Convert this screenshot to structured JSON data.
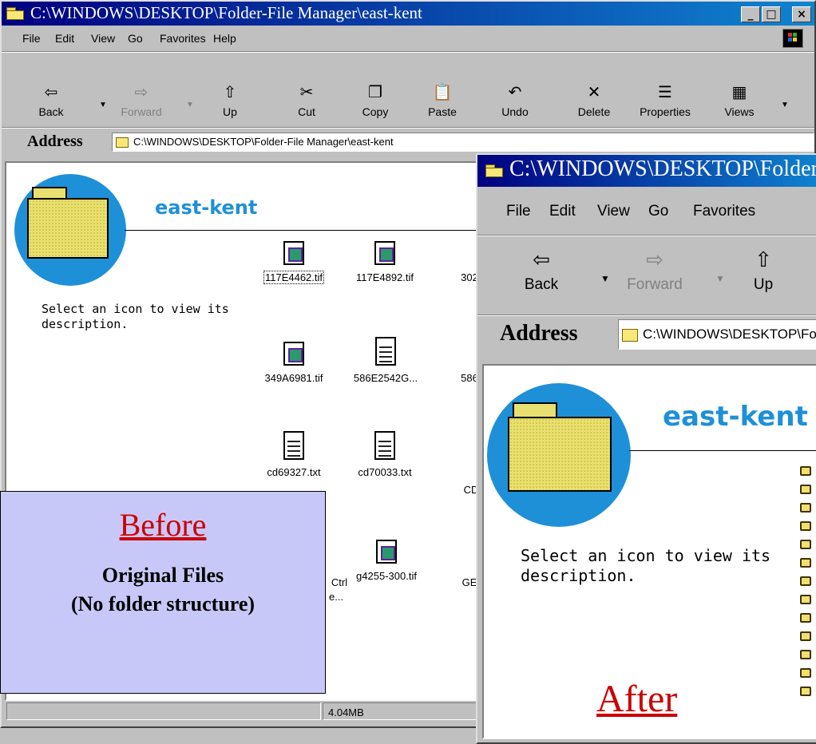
{
  "window1": {
    "title": "C:\\WINDOWS\\DESKTOP\\Folder-File Manager\\east-kent",
    "title_buttons": {
      "minimize": "_",
      "maximize": "□",
      "close": "×"
    },
    "menu": [
      "File",
      "Edit",
      "View",
      "Go",
      "Favorites",
      "Help"
    ],
    "toolbar": [
      {
        "label": "Back",
        "icon": "back-arrow-icon",
        "glyph": "⇦"
      },
      {
        "label": "Forward",
        "icon": "forward-arrow-icon",
        "glyph": "⇨"
      },
      {
        "label": "Up",
        "icon": "up-folder-icon",
        "glyph": "⇧"
      },
      {
        "label": "Cut",
        "icon": "scissors-icon",
        "glyph": "✂"
      },
      {
        "label": "Copy",
        "icon": "copy-icon",
        "glyph": "❐"
      },
      {
        "label": "Paste",
        "icon": "paste-icon",
        "glyph": "📋"
      },
      {
        "label": "Undo",
        "icon": "undo-icon",
        "glyph": "↶"
      },
      {
        "label": "Delete",
        "icon": "delete-icon",
        "glyph": "✕"
      },
      {
        "label": "Properties",
        "icon": "properties-icon",
        "glyph": "☰"
      },
      {
        "label": "Views",
        "icon": "views-icon",
        "glyph": "▦"
      }
    ],
    "address_label": "Address",
    "address_value": "C:\\WINDOWS\\DESKTOP\\Folder-File Manager\\east-kent",
    "folder_title": "east-kent",
    "description": "Select an icon to view its description.",
    "files": [
      {
        "name": "117E4462.tif",
        "type": "tif"
      },
      {
        "name": "117E4892.tif",
        "type": "tif"
      },
      {
        "name": "302",
        "type": "tif"
      },
      {
        "name": "349A6981.tif",
        "type": "tif"
      },
      {
        "name": "586E2542G...",
        "type": "txt"
      },
      {
        "name": "586",
        "type": "txt"
      },
      {
        "name": "cd69327.txt",
        "type": "txt"
      },
      {
        "name": "cd70033.txt",
        "type": "txt"
      },
      {
        "name": "CD",
        "type": "txt"
      },
      {
        "name": "Ctrl",
        "type": "txt"
      },
      {
        "name": "g4255-300.tif",
        "type": "tif"
      },
      {
        "name": "GE",
        "type": "txt"
      }
    ],
    "status_size": "4.04MB"
  },
  "window2": {
    "title": "C:\\WINDOWS\\DESKTOP\\Folder-File Manager\\east-kent",
    "menu": [
      "File",
      "Edit",
      "View",
      "Go",
      "Favorites"
    ],
    "toolbar": [
      {
        "label": "Back",
        "icon": "back-arrow-icon",
        "glyph": "⇦"
      },
      {
        "label": "Forward",
        "icon": "forward-arrow-icon",
        "glyph": "⇨"
      },
      {
        "label": "Up",
        "icon": "up-folder-icon",
        "glyph": "⇧"
      }
    ],
    "address_label": "Address",
    "address_value": "C:\\WINDOWS\\DESKTOP\\Folder-File Manager\\east-kent",
    "folder_title": "east-kent",
    "description": "Select an icon to view its description."
  },
  "callouts": {
    "before_heading": "Before",
    "before_line1": "Original Files",
    "before_line2": "(No folder structure)",
    "after_heading": "After"
  },
  "colors": {
    "title_bar": "#000080",
    "folder_title": "#1e90d8",
    "callout_bg": "#c8c8f8",
    "callout_heading": "#cc0000"
  }
}
